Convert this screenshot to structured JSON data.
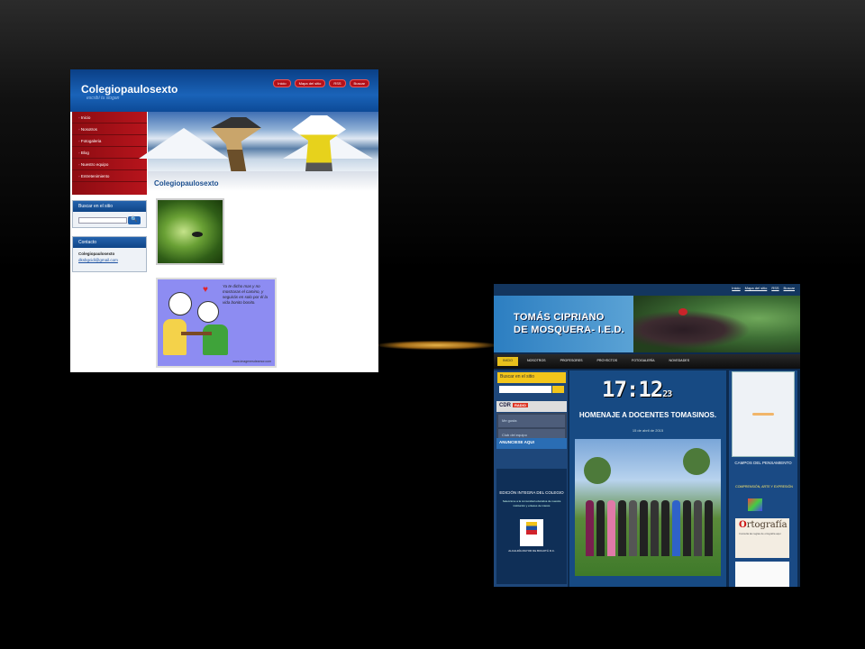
{
  "shot1": {
    "site_title": "Colegiopaulosexto",
    "slogan": "escribí tu slogan",
    "top_links": [
      "Inicio",
      "Mapa del sitio",
      "RSS",
      "Buscar"
    ],
    "menu": [
      "Inicio",
      "Nosotros",
      "Fotogaleria",
      "Blog",
      "Nuestro equipo",
      "Entretenimiento"
    ],
    "page_title": "Colegiopaulosexto",
    "search_box": {
      "title": "Buscar en el sitio",
      "button": "🔍"
    },
    "contact_box": {
      "title": "Contacto",
      "name": "Colegiopaulosexto",
      "email": "dksbgcidi@gmail.com"
    },
    "cartoon_quote": "Ya te dicho mas y no mostraras el camino, y seguirás en solo por él la vida bonito bonito.",
    "cartoon_site": "www.imagenesdeamor.com"
  },
  "shot2": {
    "top_links": [
      "Inicio",
      "Mapa del sitio",
      "RSS",
      "Buscar"
    ],
    "title_line1": "TOMÁS CIPRIANO",
    "title_line2": "DE MOSQUERA- I.E.D.",
    "nav": [
      "INICIO",
      "NOSOTROS",
      "PROFESORES",
      "PROYECTOS",
      "FOTOGALERÍA",
      "NOVEDADES"
    ],
    "search_title": "Buscar en el sitio",
    "cdr": "CDR",
    "cdr_badge": "RADIO",
    "fb_items": [
      "Me gusta",
      "Club del equipo"
    ],
    "ads": "ANUNCIESE AQUI",
    "left_box_title": "EDICIÓN INTEGRA DEL COLEGIO",
    "left_box_text": "Seleccione a la comunidad educativa de nuestra institución y enlaces de interés",
    "alcaldia": "ALCALDÍA MAYOR DE BOGOTÁ D.C.",
    "clock": "17:12",
    "clock_sec": "23",
    "homenaje": "HOMENAJE A DOCENTES TOMASINOS.",
    "date": "15 de abril de 2015",
    "campos": "CAMPOS DEL PENSAMIENTO",
    "comp": "COMPRENSIÓN, ARTE Y EXPRESIÓN",
    "ort_word_a": "O",
    "ort_word_b": "rtografía",
    "ort_text": "Consulta las reglas de ortografía aquí"
  }
}
